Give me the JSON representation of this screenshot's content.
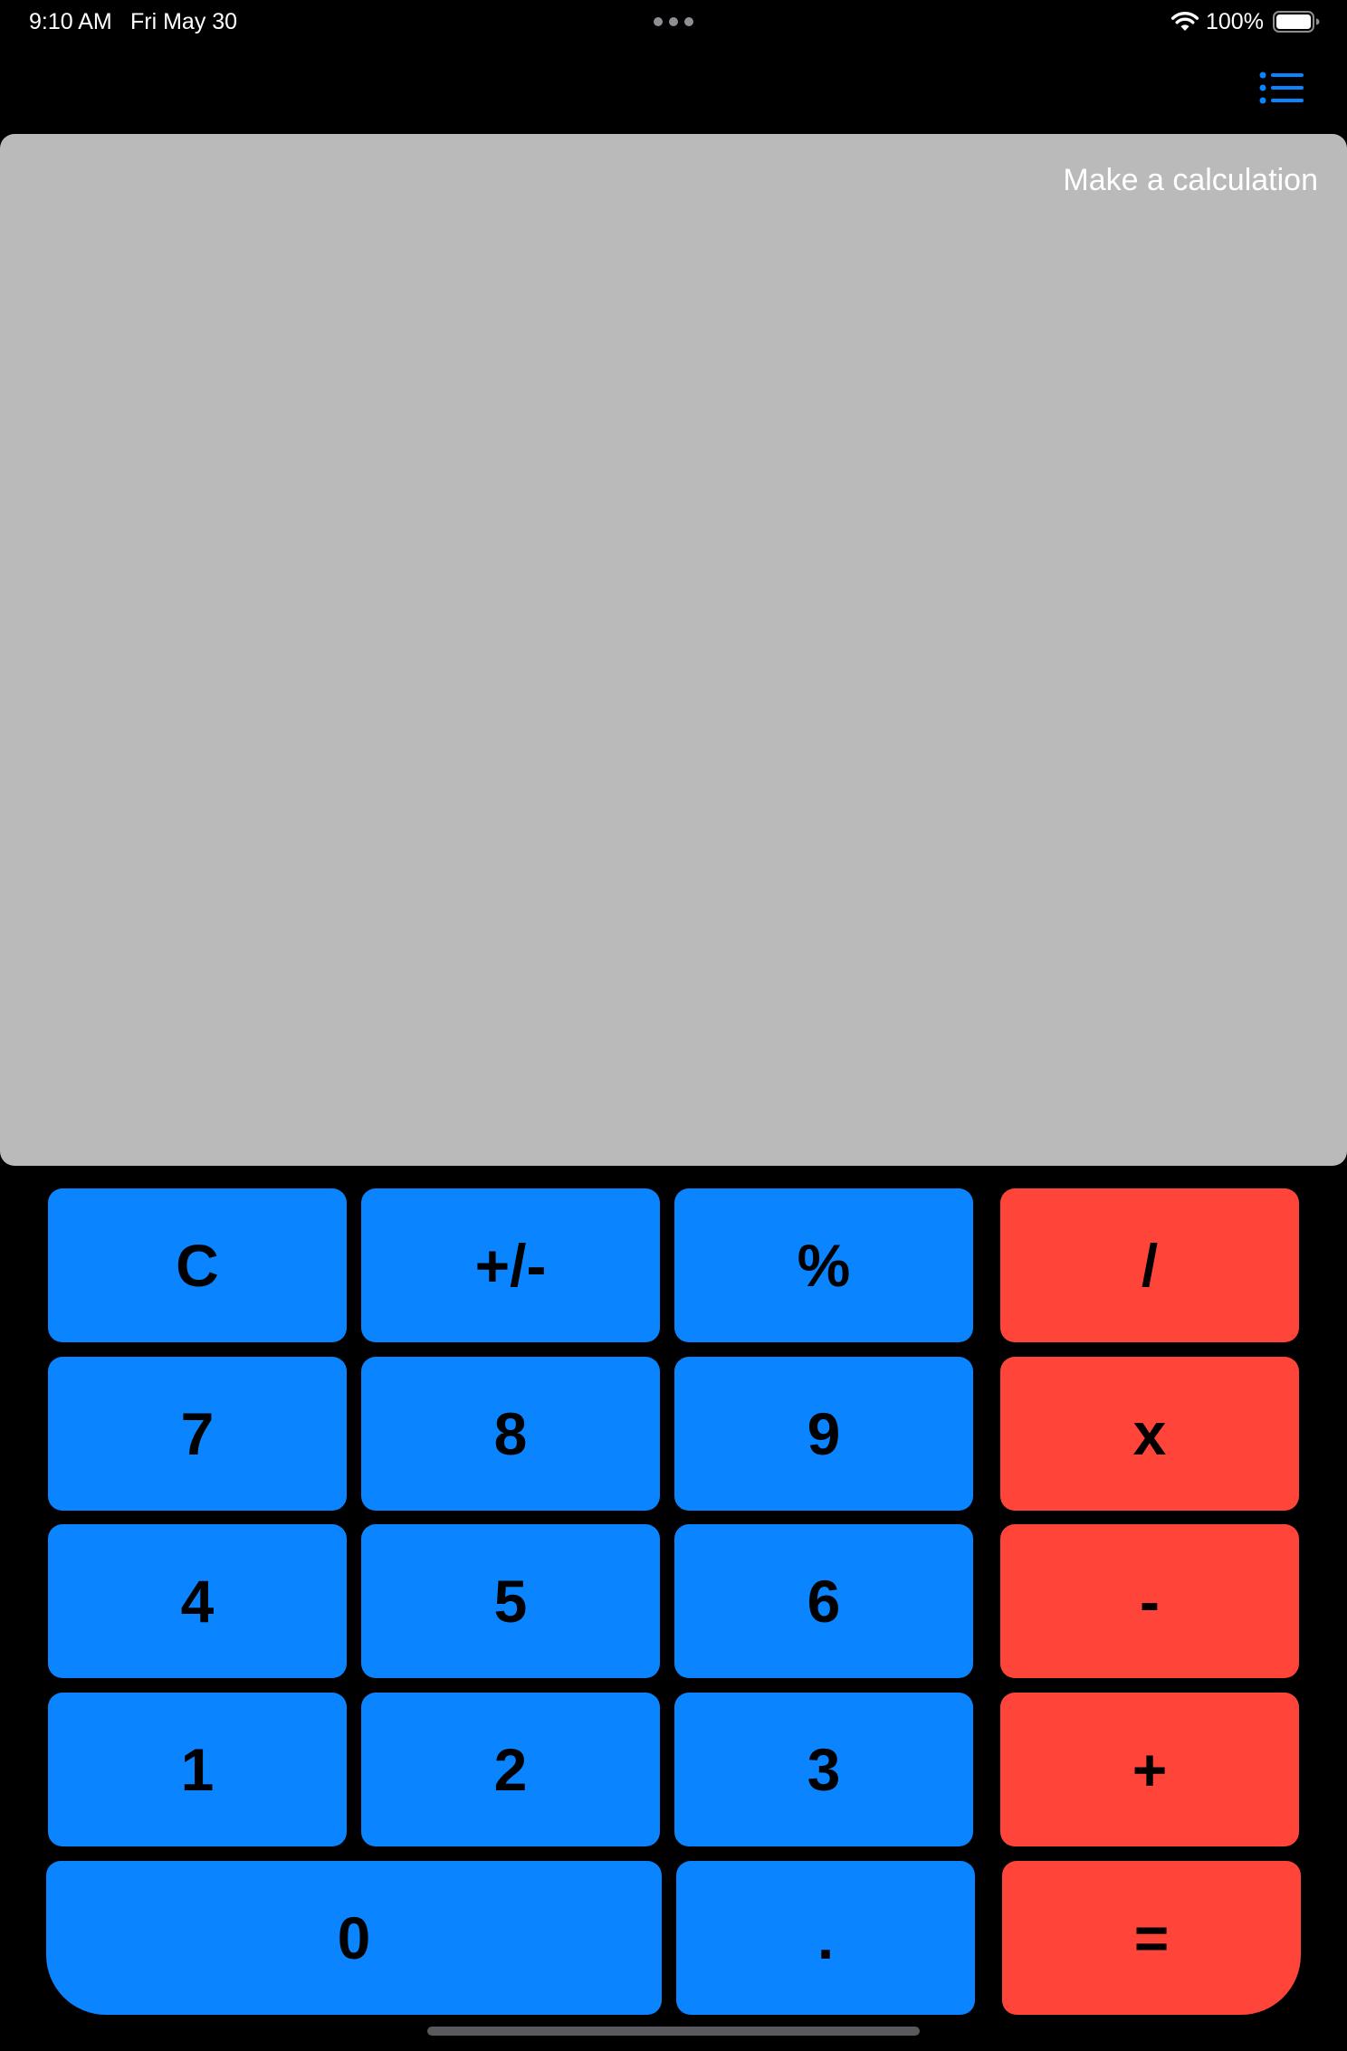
{
  "status_bar": {
    "time": "9:10 AM",
    "date": "Fri May 30",
    "battery_percent": "100%",
    "battery_level": 1.0
  },
  "nav": {
    "list_icon": "list-bullet-icon",
    "accent_color": "#0a84ff"
  },
  "display": {
    "text": "Make a calculation",
    "background_color": "#bababa"
  },
  "keypad": {
    "number_color": "#0a84ff",
    "operator_color": "#ff453a",
    "rows": [
      [
        "C",
        "+/-",
        "%",
        "/"
      ],
      [
        "7",
        "8",
        "9",
        "x"
      ],
      [
        "4",
        "5",
        "6",
        "-"
      ],
      [
        "1",
        "2",
        "3",
        "+"
      ],
      [
        "0",
        ".",
        "="
      ]
    ]
  }
}
